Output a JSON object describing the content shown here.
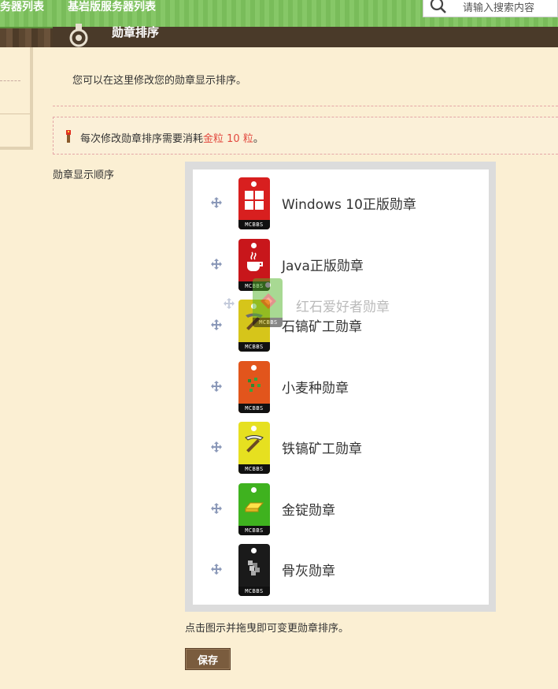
{
  "nav": {
    "items": [
      "务器列表",
      "基岩版服务器列表"
    ],
    "search_placeholder": "请输入搜索内容"
  },
  "page": {
    "title": "勋章排序",
    "intro": "您可以在这里修改您的勋章显示排序。",
    "notice_prefix": "每次修改勋章排序需要消耗",
    "notice_cost": "金粒 10 粒",
    "notice_suffix": "。",
    "order_label": "勋章显示顺序",
    "drag_hint": "点击图示并拖曳即可变更勋章排序。",
    "save_label": "保存"
  },
  "medal_tag_footer": "MCBBS",
  "medals": [
    {
      "name": "Windows 10正版勋章",
      "icon": "windows-logo",
      "color": "#d81f1f"
    },
    {
      "name": "Java正版勋章",
      "icon": "java-cup",
      "color": "#c8161b"
    },
    {
      "name": "石镐矿工勋章",
      "icon": "stone-pickaxe",
      "color": "#d6c51a"
    },
    {
      "name": "小麦种勋章",
      "icon": "wheat-seeds",
      "color": "#e2551c"
    },
    {
      "name": "铁镐矿工勋章",
      "icon": "iron-pickaxe",
      "color": "#e6e020"
    },
    {
      "name": "金锭勋章",
      "icon": "gold-ingot",
      "color": "#3fb21f"
    },
    {
      "name": "骨灰勋章",
      "icon": "bone-ash",
      "color": "#1a1a1a"
    }
  ],
  "dragging_medal": {
    "name": "红石爱好者勋章",
    "icon": "redstone",
    "color": "#53b52a"
  }
}
